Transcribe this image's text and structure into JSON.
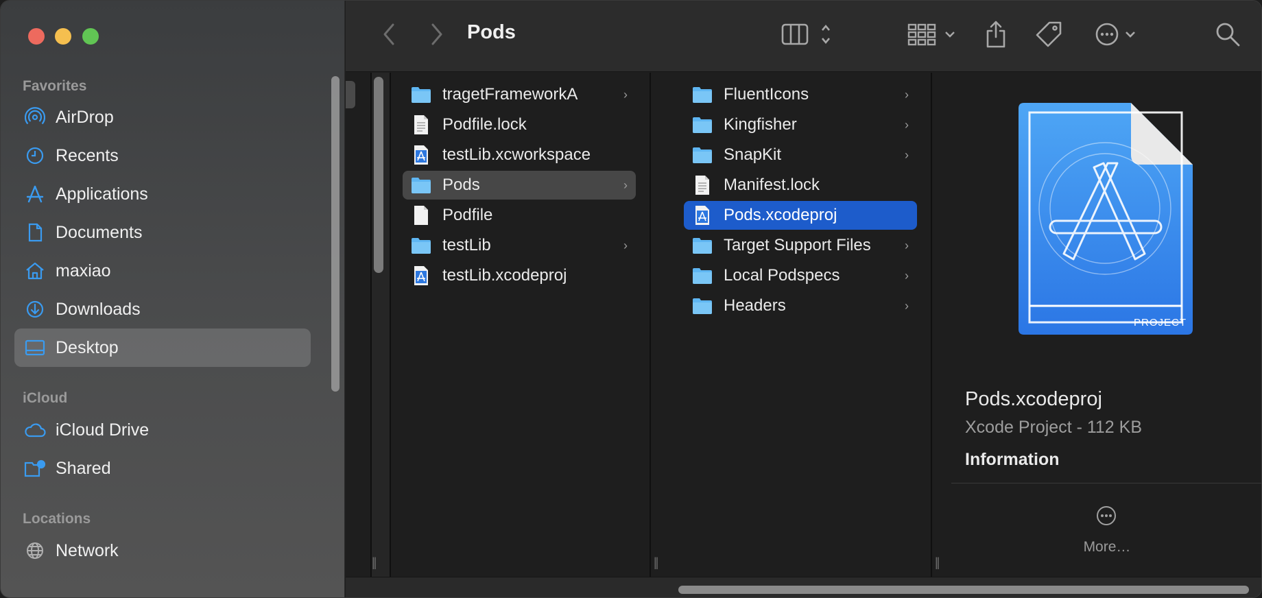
{
  "window": {
    "title": "Pods"
  },
  "sidebar": {
    "favorites_title": "Favorites",
    "icloud_title": "iCloud",
    "locations_title": "Locations",
    "favorites": [
      {
        "label": "AirDrop",
        "icon": "airdrop-icon"
      },
      {
        "label": "Recents",
        "icon": "clock-icon"
      },
      {
        "label": "Applications",
        "icon": "applications-icon"
      },
      {
        "label": "Documents",
        "icon": "document-icon"
      },
      {
        "label": "maxiao",
        "icon": "home-icon"
      },
      {
        "label": "Downloads",
        "icon": "download-icon"
      },
      {
        "label": "Desktop",
        "icon": "desktop-icon",
        "selected": true
      }
    ],
    "icloud": [
      {
        "label": "iCloud Drive",
        "icon": "cloud-icon"
      },
      {
        "label": "Shared",
        "icon": "shared-folder-icon"
      }
    ],
    "locations": [
      {
        "label": "Network",
        "icon": "globe-icon"
      }
    ]
  },
  "columns": {
    "col1": [
      {
        "name": "tragetFrameworkA",
        "type": "folder",
        "has_children": true
      },
      {
        "name": "Podfile.lock",
        "type": "text"
      },
      {
        "name": "testLib.xcworkspace",
        "type": "xcode"
      },
      {
        "name": "Pods",
        "type": "folder",
        "has_children": true,
        "selected": true
      },
      {
        "name": "Podfile",
        "type": "blank"
      },
      {
        "name": "testLib",
        "type": "folder",
        "has_children": true
      },
      {
        "name": "testLib.xcodeproj",
        "type": "xcode"
      }
    ],
    "col2": [
      {
        "name": "FluentIcons",
        "type": "folder",
        "has_children": true
      },
      {
        "name": "Kingfisher",
        "type": "folder",
        "has_children": true
      },
      {
        "name": "SnapKit",
        "type": "folder",
        "has_children": true
      },
      {
        "name": "Manifest.lock",
        "type": "text"
      },
      {
        "name": "Pods.xcodeproj",
        "type": "xcode",
        "selected": true
      },
      {
        "name": "Target Support Files",
        "type": "folder",
        "has_children": true
      },
      {
        "name": "Local Podspecs",
        "type": "folder",
        "has_children": true
      },
      {
        "name": "Headers",
        "type": "folder",
        "has_children": true
      }
    ]
  },
  "preview": {
    "name": "Pods.xcodeproj",
    "kind": "Xcode Project - 112 KB",
    "info_title": "Information",
    "more_label": "More…",
    "badge": "PROJECT"
  },
  "colors": {
    "selection_blue": "#1d5ccb",
    "folder_blue": "#5fb6f2",
    "accent_icon": "#3a9bf0"
  }
}
